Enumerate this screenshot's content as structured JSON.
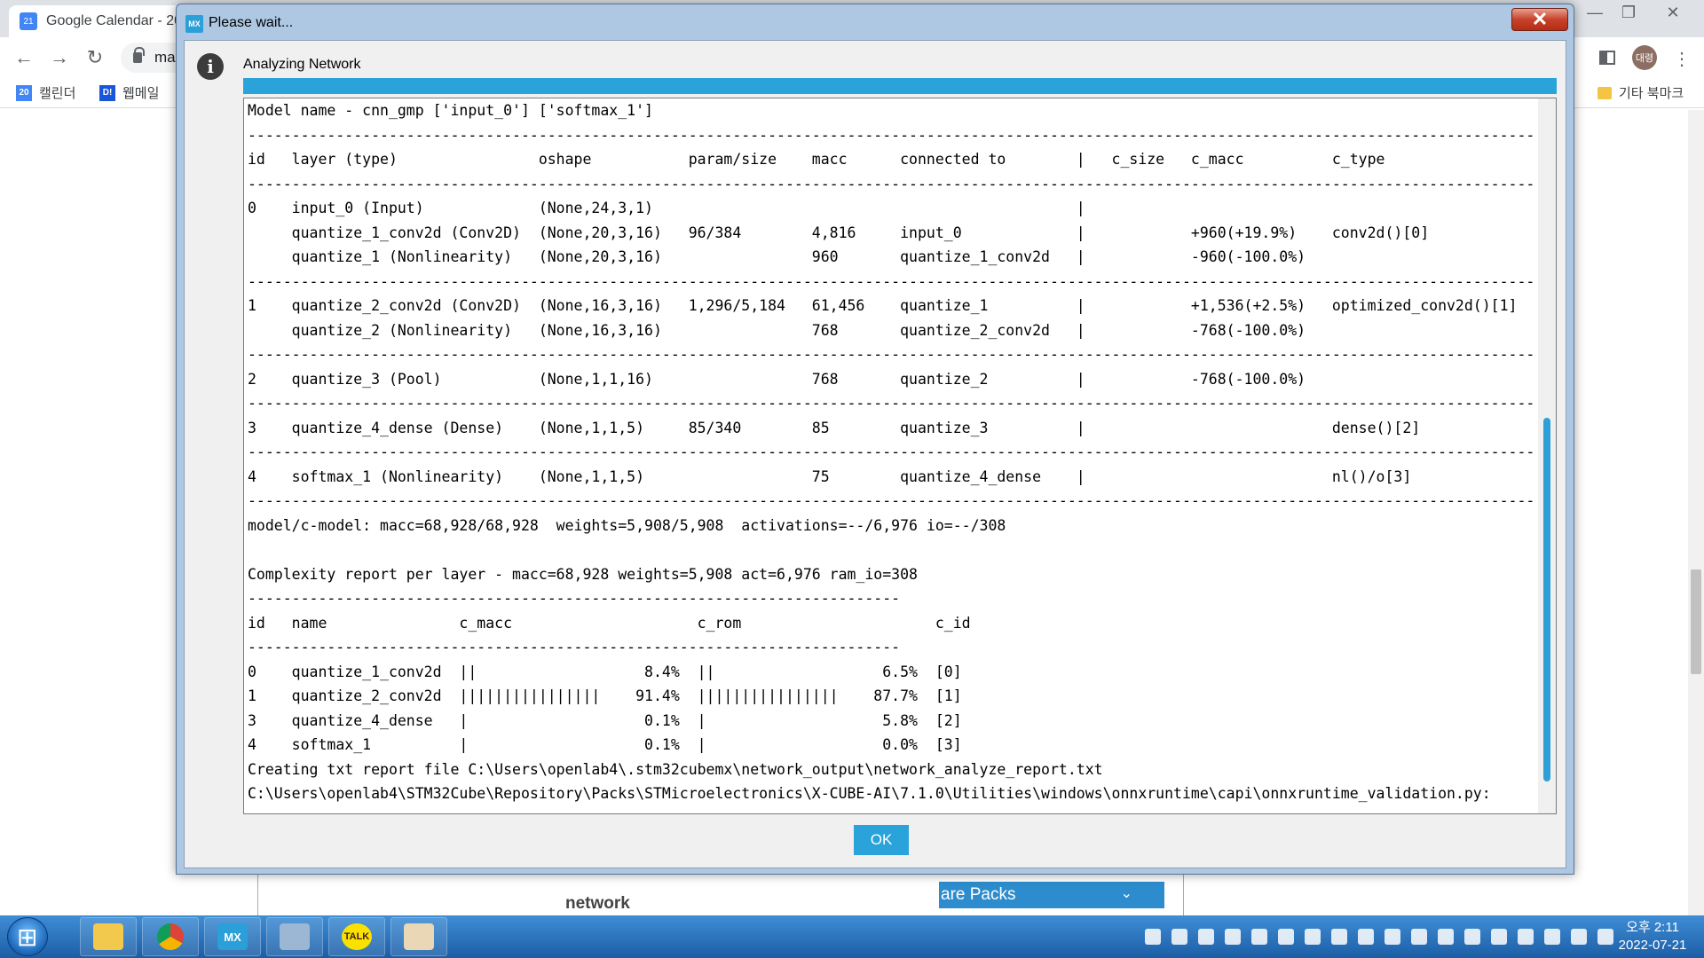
{
  "browser": {
    "active_tab_title": "Google Calendar - 20",
    "address_partial": "ma",
    "bookmarks": [
      {
        "label": "캘린더",
        "icon": "calendar-icon",
        "icon_text": "20"
      },
      {
        "label": "웹메일",
        "icon": "webmail-icon",
        "icon_text": "D!"
      }
    ],
    "other_bookmarks": "기타 북마크",
    "avatar_text": "대령"
  },
  "dialog": {
    "title": "Please wait...",
    "app_icon_text": "MX",
    "heading": "Analyzing Network",
    "progress_percent": 100,
    "ok_label": "OK",
    "console_lines": [
      "Model name - cnn_gmp ['input_0'] ['softmax_1']",
      "-----------------------------------------------------------------------------------------------------------------------------------------------------------",
      "id   layer (type)                oshape           param/size    macc      connected to        |   c_size   c_macc          c_type",
      "-----------------------------------------------------------------------------------------------------------------------------------------------------------",
      "0    input_0 (Input)             (None,24,3,1)                                                |",
      "     quantize_1_conv2d (Conv2D)  (None,20,3,16)   96/384        4,816     input_0             |            +960(+19.9%)    conv2d()[0]",
      "     quantize_1 (Nonlinearity)   (None,20,3,16)                 960       quantize_1_conv2d   |            -960(-100.0%)",
      "-----------------------------------------------------------------------------------------------------------------------------------------------------------",
      "1    quantize_2_conv2d (Conv2D)  (None,16,3,16)   1,296/5,184   61,456    quantize_1          |            +1,536(+2.5%)   optimized_conv2d()[1]",
      "     quantize_2 (Nonlinearity)   (None,16,3,16)                 768       quantize_2_conv2d   |            -768(-100.0%)",
      "-----------------------------------------------------------------------------------------------------------------------------------------------------------",
      "2    quantize_3 (Pool)           (None,1,1,16)                  768       quantize_2          |            -768(-100.0%)",
      "-----------------------------------------------------------------------------------------------------------------------------------------------------------",
      "3    quantize_4_dense (Dense)    (None,1,1,5)     85/340        85        quantize_3          |                            dense()[2]",
      "-----------------------------------------------------------------------------------------------------------------------------------------------------------",
      "4    softmax_1 (Nonlinearity)    (None,1,1,5)                   75        quantize_4_dense    |                            nl()/o[3]",
      "-----------------------------------------------------------------------------------------------------------------------------------------------------------",
      "model/c-model: macc=68,928/68,928  weights=5,908/5,908  activations=--/6,976 io=--/308",
      "",
      "Complexity report per layer - macc=68,928 weights=5,908 act=6,976 ram_io=308",
      "--------------------------------------------------------------------------",
      "id   name               c_macc                     c_rom                      c_id",
      "--------------------------------------------------------------------------",
      "0    quantize_1_conv2d  ||                   8.4%  ||                   6.5%  [0]",
      "1    quantize_2_conv2d  ||||||||||||||||    91.4%  ||||||||||||||||    87.7%  [1]",
      "3    quantize_4_dense   |                    0.1%  |                    5.8%  [2]",
      "4    softmax_1          |                    0.1%  |                    0.0%  [3]",
      "Creating txt report file C:\\Users\\openlab4\\.stm32cubemx\\network_output\\network_analyze_report.txt",
      "C:\\Users\\openlab4\\STM32Cube\\Repository\\Packs\\STMicroelectronics\\X-CUBE-AI\\7.1.0\\Utilities\\windows\\onnxruntime\\capi\\onnxruntime_validation.py:"
    ]
  },
  "background_page": {
    "network_label": "network",
    "select_text": "are Packs"
  },
  "taskbar": {
    "apps": [
      {
        "name": "explorer",
        "icon": "folder-icon",
        "text": ""
      },
      {
        "name": "chrome",
        "icon": "chrome-icon",
        "text": ""
      },
      {
        "name": "stm32cubemx",
        "icon": "mx-icon",
        "text": "MX"
      },
      {
        "name": "notepad",
        "icon": "notepad-icon",
        "text": ""
      },
      {
        "name": "kakaotalk",
        "icon": "talk-icon",
        "text": "TALK"
      },
      {
        "name": "paint",
        "icon": "paint-icon",
        "text": ""
      }
    ],
    "clock_time": "오후 2:11",
    "clock_date": "2022-07-21"
  }
}
